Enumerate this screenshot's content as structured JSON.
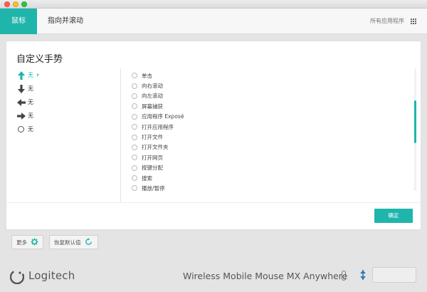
{
  "window": {
    "controls": [
      "close",
      "minimize",
      "maximize"
    ]
  },
  "nav": {
    "tabs": [
      {
        "label": "鼠标",
        "active": true
      },
      {
        "label": "指向并滚动",
        "active": false
      }
    ],
    "apps_label": "所有应用程序",
    "apps_icon": "grid-icon"
  },
  "panel": {
    "title": "自定义手势",
    "gestures": [
      {
        "direction": "up",
        "label": "无",
        "selected": true,
        "icon": "arrow-up-icon"
      },
      {
        "direction": "down",
        "label": "无",
        "selected": false,
        "icon": "arrow-down-icon"
      },
      {
        "direction": "left",
        "label": "无",
        "selected": false,
        "icon": "arrow-left-icon"
      },
      {
        "direction": "right",
        "label": "无",
        "selected": false,
        "icon": "arrow-right-icon"
      },
      {
        "direction": "tap",
        "label": "无",
        "selected": false,
        "icon": "circle-icon"
      }
    ],
    "selected_chevron": "›",
    "actions": [
      "单击",
      "向右滚动",
      "向左滚动",
      "屏幕捕获",
      "应用程序 Exposé",
      "打开应用程序",
      "打开文件",
      "打开文件夹",
      "打开网页",
      "按键分配",
      "搜索",
      "播放/暂停"
    ],
    "ok_label": "确定"
  },
  "bottom": {
    "more_label": "更多",
    "more_icon": "gear-icon",
    "restore_label": "恢复默认值",
    "restore_icon": "refresh-icon"
  },
  "footer": {
    "brand": "Logitech",
    "device_name": "Wireless Mobile Mouse MX Anywhere"
  },
  "colors": {
    "accent": "#1fb5ab",
    "background": "#e4e4e4"
  }
}
